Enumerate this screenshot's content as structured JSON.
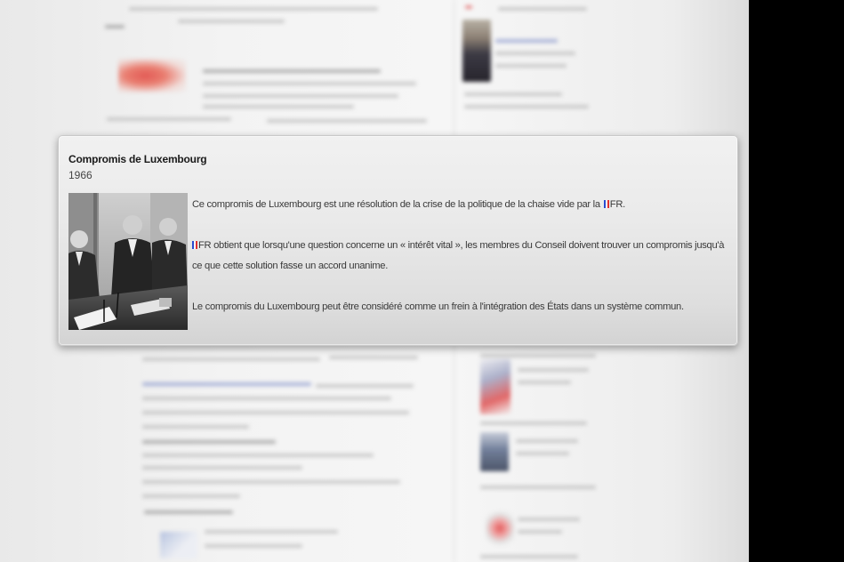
{
  "card": {
    "title": "Compromis de Luxembourg",
    "year": "1966",
    "photo": {
      "name": "black-and-white-photo-signing-meeting"
    },
    "paragraphs": [
      {
        "before": "Ce compromis de Luxembourg est une résolution de la crise de la politique de la chaise vide par la",
        "flag": "french-flag-icon",
        "code": "FR",
        "after": "."
      },
      {
        "flag": "french-flag-icon",
        "code": "FR",
        "after": " obtient que lorsqu'une question concerne un « intérêt vital », les membres du Conseil doivent trouver un compromis jusqu'à ce que cette solution fasse un accord unanime."
      },
      {
        "text": "Le compromis du Luxembourg peut être considéré comme un frein à l'intégration des États dans un système commun."
      }
    ]
  },
  "colors": {
    "flag_blue": "#2a4bd0",
    "flag_white": "#ffffff",
    "flag_red": "#e03030",
    "background": "#000000"
  }
}
